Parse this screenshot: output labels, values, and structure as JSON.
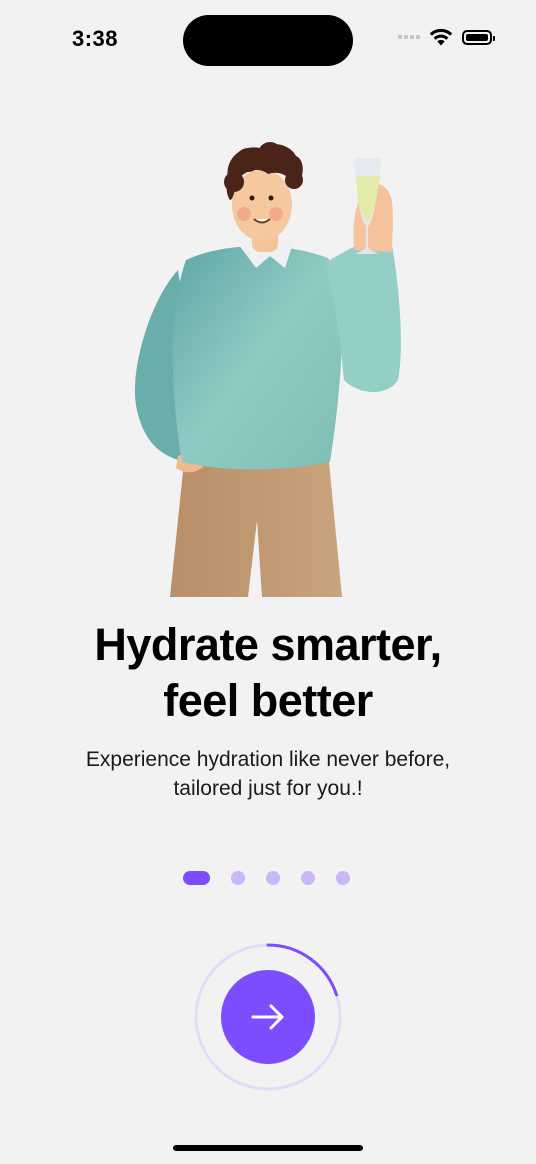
{
  "status_bar": {
    "time": "3:38"
  },
  "onboarding": {
    "headline_line1": "Hydrate smarter,",
    "headline_line2": "feel better",
    "subtitle_line1": "Experience hydration like never before,",
    "subtitle_line2": "tailored just for you.!"
  },
  "pager": {
    "page_count": 5,
    "active_index": 0
  },
  "next_button": {
    "icon": "arrow-right-icon",
    "progress_fraction": 0.2
  },
  "colors": {
    "accent": "#7c4dff",
    "dot_inactive": "#c9b8f5",
    "ring_track": "#e2dcfa",
    "background": "#f2f2f2",
    "sweater": "#8cc9c2",
    "pants": "#c19a72",
    "hair": "#4a2418",
    "skin": "#f6c8a0"
  }
}
